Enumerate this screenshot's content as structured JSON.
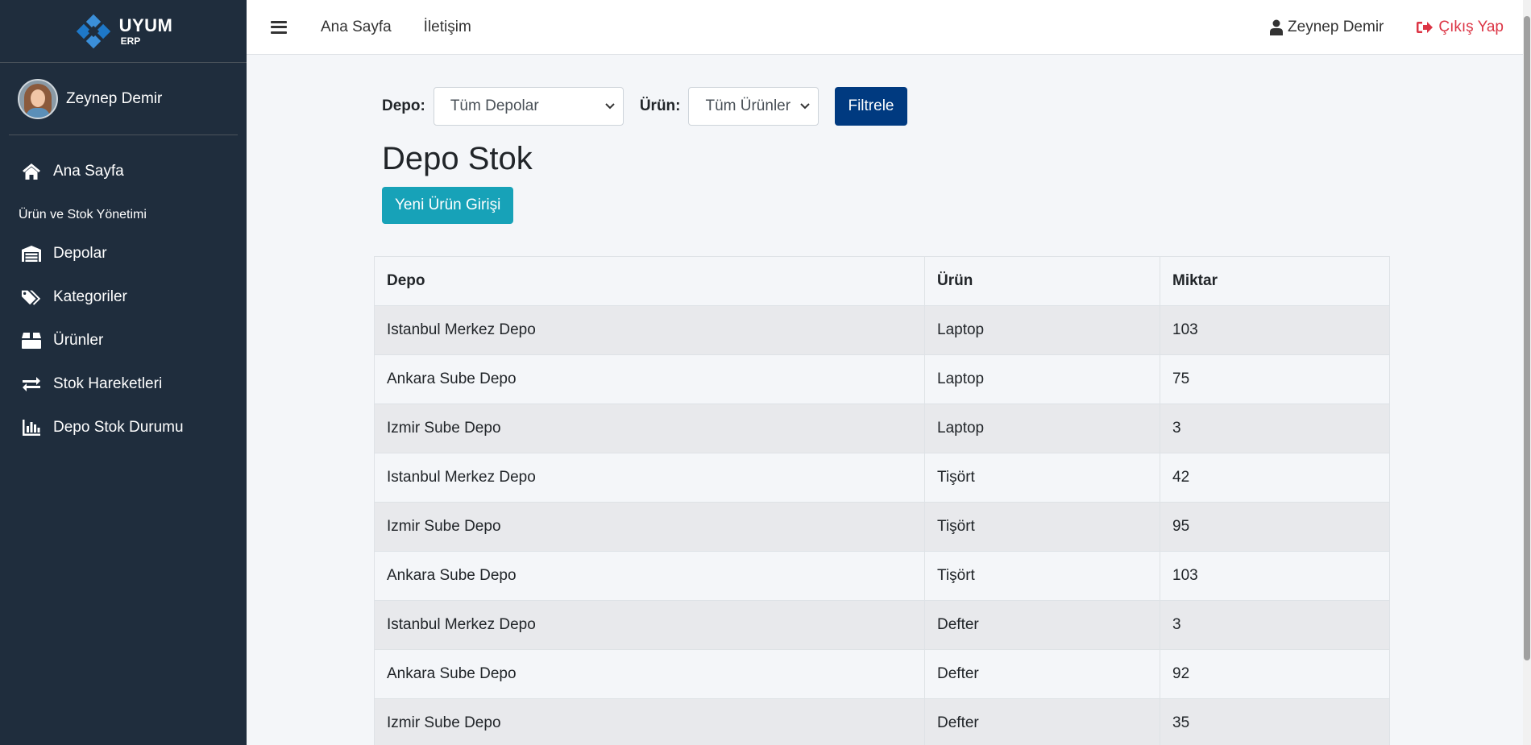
{
  "brand": {
    "name": "UYUM",
    "sub": "ERP"
  },
  "sidebar": {
    "user_name": "Zeynep Demir",
    "home_label": "Ana Sayfa",
    "section_header": "Ürün ve Stok Yönetimi",
    "items": [
      {
        "label": "Depolar",
        "icon": "warehouse-icon"
      },
      {
        "label": "Kategoriler",
        "icon": "tags-icon"
      },
      {
        "label": "Ürünler",
        "icon": "box-icon"
      },
      {
        "label": "Stok Hareketleri",
        "icon": "exchange-icon"
      },
      {
        "label": "Depo Stok Durumu",
        "icon": "chart-bar-icon"
      }
    ]
  },
  "topbar": {
    "links": [
      "Ana Sayfa",
      "İletişim"
    ],
    "user_name": "Zeynep Demir",
    "logout_label": "Çıkış Yap"
  },
  "filter": {
    "depot_label": "Depo:",
    "depot_selected": "Tüm Depolar",
    "product_label": "Ürün:",
    "product_selected": "Tüm Ürünler",
    "submit_label": "Filtrele"
  },
  "page": {
    "title": "Depo Stok",
    "new_entry_label": "Yeni Ürün Girişi"
  },
  "table": {
    "headers": [
      "Depo",
      "Ürün",
      "Miktar"
    ],
    "rows": [
      [
        "Istanbul Merkez Depo",
        "Laptop",
        "103"
      ],
      [
        "Ankara Sube Depo",
        "Laptop",
        "75"
      ],
      [
        "Izmir Sube Depo",
        "Laptop",
        "3"
      ],
      [
        "Istanbul Merkez Depo",
        "Tişört",
        "42"
      ],
      [
        "Izmir Sube Depo",
        "Tişört",
        "95"
      ],
      [
        "Ankara Sube Depo",
        "Tişört",
        "103"
      ],
      [
        "Istanbul Merkez Depo",
        "Defter",
        "3"
      ],
      [
        "Ankara Sube Depo",
        "Defter",
        "92"
      ],
      [
        "Izmir Sube Depo",
        "Defter",
        "35"
      ]
    ]
  },
  "colors": {
    "sidebar_bg": "#1f2d3d",
    "primary": "#003a80",
    "info": "#17a2b8",
    "danger": "#dc3545",
    "brand_blue": "#1e78c8"
  }
}
